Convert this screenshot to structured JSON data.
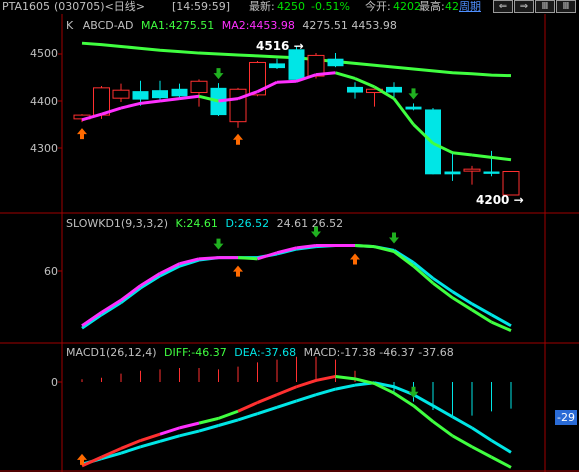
{
  "header": {
    "symbol": "PTA1605",
    "code_period": "(030705)<日线>",
    "time": "[14:59:59]",
    "latest_label": "最新:",
    "latest_value": "4250",
    "change_pct": "-0.51%",
    "open_label": "今开:",
    "open_value": "4202",
    "high_label": "最高:",
    "high_value": "42",
    "period_link": "周期",
    "nav_buttons": [
      "⇐",
      "⇒",
      "Ⅲ",
      "Ⅲ"
    ]
  },
  "price_panel": {
    "title_prefix": "K",
    "indicator": "ABCD-AD",
    "ma1_text": "MA1:4275.51",
    "ma2_text": "MA2:4453.98",
    "values_text": "4275.51  4453.98",
    "high_marker": "4516",
    "low_marker": "4200",
    "y_ticks": [
      "4500",
      "4400",
      "4300"
    ]
  },
  "kd_panel": {
    "title": "SLOWKD1(9,3,3,2)",
    "k_text": "K:24.61",
    "d_text": "D:26.52",
    "values_text": "24.61  26.52",
    "y_tick": "60"
  },
  "macd_panel": {
    "title": "MACD1(26,12,4)",
    "diff_text": "DIFF:-46.37",
    "dea_text": "DEA:-37.68",
    "macd_text": "MACD:-17.38  -46.37  -37.68",
    "y_tick": "0",
    "scale_badge": "-29"
  },
  "colors": {
    "up": "#ff3030",
    "down": "#00e6e6",
    "ma_green": "#40ff40",
    "ma_magenta": "#ff30ff",
    "arrow_orange": "#ff6a00",
    "arrow_green": "#20b020",
    "grid_red": "#a00000"
  },
  "chart_data": {
    "type": "candlestick",
    "candles": [
      {
        "o": 4362,
        "h": 4372,
        "l": 4355,
        "c": 4370
      },
      {
        "o": 4370,
        "h": 4432,
        "l": 4362,
        "c": 4428
      },
      {
        "o": 4406,
        "h": 4437,
        "l": 4398,
        "c": 4423
      },
      {
        "o": 4421,
        "h": 4443,
        "l": 4390,
        "c": 4403
      },
      {
        "o": 4423,
        "h": 4443,
        "l": 4400,
        "c": 4406
      },
      {
        "o": 4426,
        "h": 4437,
        "l": 4405,
        "c": 4410
      },
      {
        "o": 4418,
        "h": 4446,
        "l": 4388,
        "c": 4442
      },
      {
        "o": 4428,
        "h": 4438,
        "l": 4368,
        "c": 4370
      },
      {
        "o": 4356,
        "h": 4428,
        "l": 4343,
        "c": 4425
      },
      {
        "o": 4413,
        "h": 4485,
        "l": 4410,
        "c": 4482
      },
      {
        "o": 4480,
        "h": 4490,
        "l": 4468,
        "c": 4470
      },
      {
        "o": 4510,
        "h": 4516,
        "l": 4440,
        "c": 4445
      },
      {
        "o": 4453,
        "h": 4502,
        "l": 4448,
        "c": 4497
      },
      {
        "o": 4490,
        "h": 4502,
        "l": 4472,
        "c": 4474
      },
      {
        "o": 4430,
        "h": 4440,
        "l": 4405,
        "c": 4418
      },
      {
        "o": 4418,
        "h": 4426,
        "l": 4388,
        "c": 4425
      },
      {
        "o": 4430,
        "h": 4440,
        "l": 4405,
        "c": 4418
      },
      {
        "o": 4388,
        "h": 4395,
        "l": 4380,
        "c": 4382
      },
      {
        "o": 4382,
        "h": 4385,
        "l": 4244,
        "c": 4244
      },
      {
        "o": 4250,
        "h": 4290,
        "l": 4230,
        "c": 4244
      },
      {
        "o": 4255,
        "h": 4262,
        "l": 4222,
        "c": 4255
      },
      {
        "o": 4250,
        "h": 4294,
        "l": 4240,
        "c": 4245
      },
      {
        "o": 4200,
        "h": 4250,
        "l": 4200,
        "c": 4250
      }
    ],
    "ma1": [
      4360,
      4372,
      4385,
      4395,
      4400,
      4405,
      4410,
      4400,
      4405,
      4420,
      4440,
      4442,
      4456,
      4460,
      4448,
      4430,
      4405,
      4350,
      4310,
      4290,
      4285,
      4280,
      4275
    ],
    "ma2": [
      4523,
      4520,
      4516,
      4512,
      4508,
      4505,
      4502,
      4500,
      4498,
      4496,
      4494,
      4492,
      4488,
      4484,
      4480,
      4476,
      4472,
      4468,
      4464,
      4460,
      4458,
      4455,
      4454
    ],
    "slowk": [
      15,
      26,
      36,
      48,
      58,
      66,
      70,
      71,
      71,
      70,
      75,
      79,
      81,
      81,
      81,
      80,
      76,
      64,
      50,
      38,
      28,
      18,
      11
    ],
    "slowd": [
      13,
      24,
      34,
      46,
      56,
      64,
      69,
      71,
      71,
      71,
      74,
      78,
      80,
      81,
      81,
      80,
      77,
      67,
      54,
      43,
      33,
      24,
      15
    ],
    "diff": [
      -106,
      -95,
      -84,
      -74,
      -66,
      -58,
      -52,
      -46,
      -37,
      -26,
      -16,
      -6,
      2,
      7,
      4,
      -2,
      -14,
      -30,
      -50,
      -68,
      -82,
      -95,
      -108
    ],
    "dea": [
      -104,
      -97,
      -90,
      -82,
      -75,
      -68,
      -62,
      -55,
      -48,
      -40,
      -32,
      -24,
      -16,
      -9,
      -4,
      -1,
      -6,
      -16,
      -30,
      -44,
      -58,
      -74,
      -89
    ],
    "macd_hist": [
      2,
      3,
      6,
      8,
      9,
      10,
      10,
      9,
      11,
      14,
      16,
      18,
      18,
      16,
      8,
      -1,
      -8,
      -14,
      -20,
      -24,
      -24,
      -21,
      -19
    ],
    "kd_arrows": [
      {
        "i": 7,
        "dir": "down"
      },
      {
        "i": 8,
        "dir": "up"
      },
      {
        "i": 12,
        "dir": "down"
      },
      {
        "i": 14,
        "dir": "up"
      },
      {
        "i": 16,
        "dir": "down"
      }
    ],
    "price_arrows": [
      {
        "i": 0,
        "dir": "up"
      },
      {
        "i": 7,
        "dir": "down"
      },
      {
        "i": 8,
        "dir": "up"
      },
      {
        "i": 17,
        "dir": "down"
      }
    ]
  }
}
